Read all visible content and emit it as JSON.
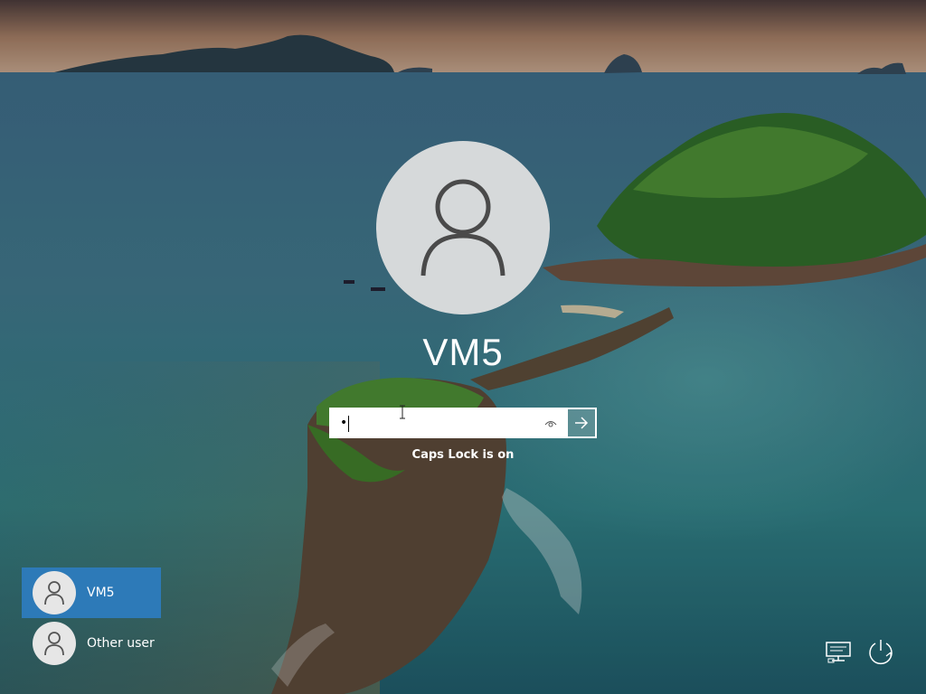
{
  "lock_screen": {
    "username": "VM5",
    "password": {
      "value": "•",
      "placeholder": "",
      "reveal_icon": "eye-icon",
      "submit_icon": "arrow-right-icon"
    },
    "caps_lock_message": "Caps Lock is on"
  },
  "user_list": [
    {
      "label": "VM5",
      "selected": true,
      "icon": "user-icon"
    },
    {
      "label": "Other user",
      "selected": false,
      "icon": "user-icon"
    }
  ],
  "corner_icons": [
    {
      "name": "network",
      "icon": "network-icon"
    },
    {
      "name": "power",
      "icon": "power-icon"
    }
  ],
  "colors": {
    "selected_tile": "#2d7ab8",
    "text": "#ffffff",
    "avatar_bg": "#e2e2e2"
  }
}
